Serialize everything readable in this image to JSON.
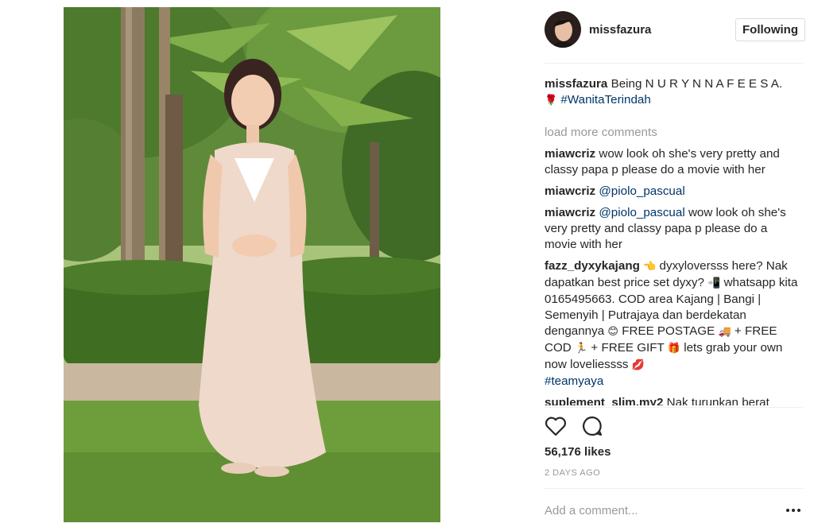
{
  "post": {
    "username": "missfazura",
    "follow_label": "Following",
    "caption": {
      "user": "missfazura",
      "text": "Being N U R Y N N A F E E S A.",
      "emoji": "🌹",
      "hashtag": "#WanitaTerindah"
    },
    "load_more": "load more comments",
    "comments": [
      {
        "user": "miawcriz",
        "text": "wow look oh she's very pretty and classy papa p please do a movie with her"
      },
      {
        "user": "miawcriz",
        "mention": "@piolo_pascual",
        "text": ""
      },
      {
        "user": "miawcriz",
        "mention": "@piolo_pascual",
        "text": "wow look oh she's very pretty and classy papa p please do a movie with her"
      },
      {
        "user": "fazz_dyxykajang",
        "segments": [
          "👈",
          "dyxyloversss here? Nak dapatkan best price set dyxy?",
          "📲",
          "whatsapp kita 0165495663. COD area Kajang | Bangi | Semenyih | Putrajaya dan berdekatan dengannya",
          "😊",
          "FREE POSTAGE",
          "🚚",
          "+ FREE COD",
          "🏃",
          "+ FREE GIFT",
          "🎁",
          "lets grab your own now loveliessss",
          "💋"
        ],
        "hashtag": "#teamyaya"
      },
      {
        "user": "suplement_slim.my2",
        "text": "Nak turunkan berat"
      }
    ],
    "likes": "56,176 likes",
    "timestamp": "2 DAYS AGO",
    "add_comment_placeholder": "Add a comment...",
    "icons": {
      "like": "heart-icon",
      "comment": "speech-bubble-icon",
      "more": "more-options-icon"
    },
    "colors": {
      "text": "#262626",
      "muted": "#999999",
      "link": "#003569",
      "border": "#dbdbdb"
    }
  }
}
